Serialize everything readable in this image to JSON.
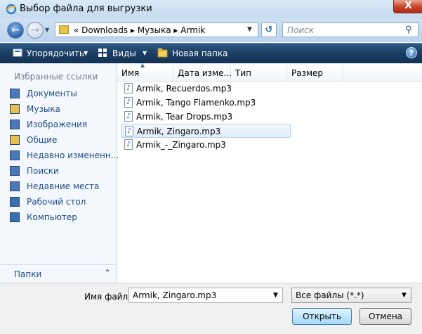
{
  "window": {
    "title": "Выбор файла для выгрузки",
    "close_glyph": "X"
  },
  "nav": {
    "path": "« Downloads ▸ Музыка ▸ Armik",
    "search_placeholder": "Поиск"
  },
  "toolbar": {
    "organize": "Упорядочить",
    "views": "Виды",
    "new_folder": "Новая папка",
    "help": "?"
  },
  "sidebar": {
    "header": "Избранные ссылки",
    "items": [
      {
        "label": "Документы",
        "icon": "documents-icon",
        "color": "#4a78b8"
      },
      {
        "label": "Музыка",
        "icon": "music-folder-icon",
        "color": "#e6c04a"
      },
      {
        "label": "Изображения",
        "icon": "pictures-icon",
        "color": "#4a78b8"
      },
      {
        "label": "Общие",
        "icon": "public-folder-icon",
        "color": "#e6c04a"
      },
      {
        "label": "Недавно измененн...",
        "icon": "recent-changed-icon",
        "color": "#4a78b8"
      },
      {
        "label": "Поиски",
        "icon": "searches-icon",
        "color": "#4a78b8"
      },
      {
        "label": "Недавние места",
        "icon": "recent-places-icon",
        "color": "#4a78b8"
      },
      {
        "label": "Рабочий стол",
        "icon": "desktop-icon",
        "color": "#3a6fb0"
      },
      {
        "label": "Компьютер",
        "icon": "computer-icon",
        "color": "#3a6fb0"
      }
    ],
    "folders_label": "Папки"
  },
  "columns": [
    "Имя",
    "Дата изме...",
    "Тип",
    "Размер"
  ],
  "files": [
    {
      "name": "Armik, Recuerdos.mp3",
      "selected": false
    },
    {
      "name": "Armik, Tango Flamenko.mp3",
      "selected": false
    },
    {
      "name": "Armik, Tear Drops.mp3",
      "selected": false
    },
    {
      "name": "Armik, Zingaro.mp3",
      "selected": true
    },
    {
      "name": "Armik_-_Zingaro.mp3",
      "selected": false
    }
  ],
  "footer": {
    "filename_label": "Имя файла:",
    "filename_value": "Armik, Zingaro.mp3",
    "filetype_value": "Все файлы (*.*)",
    "open_label": "Открыть",
    "cancel_label": "Отмена"
  }
}
